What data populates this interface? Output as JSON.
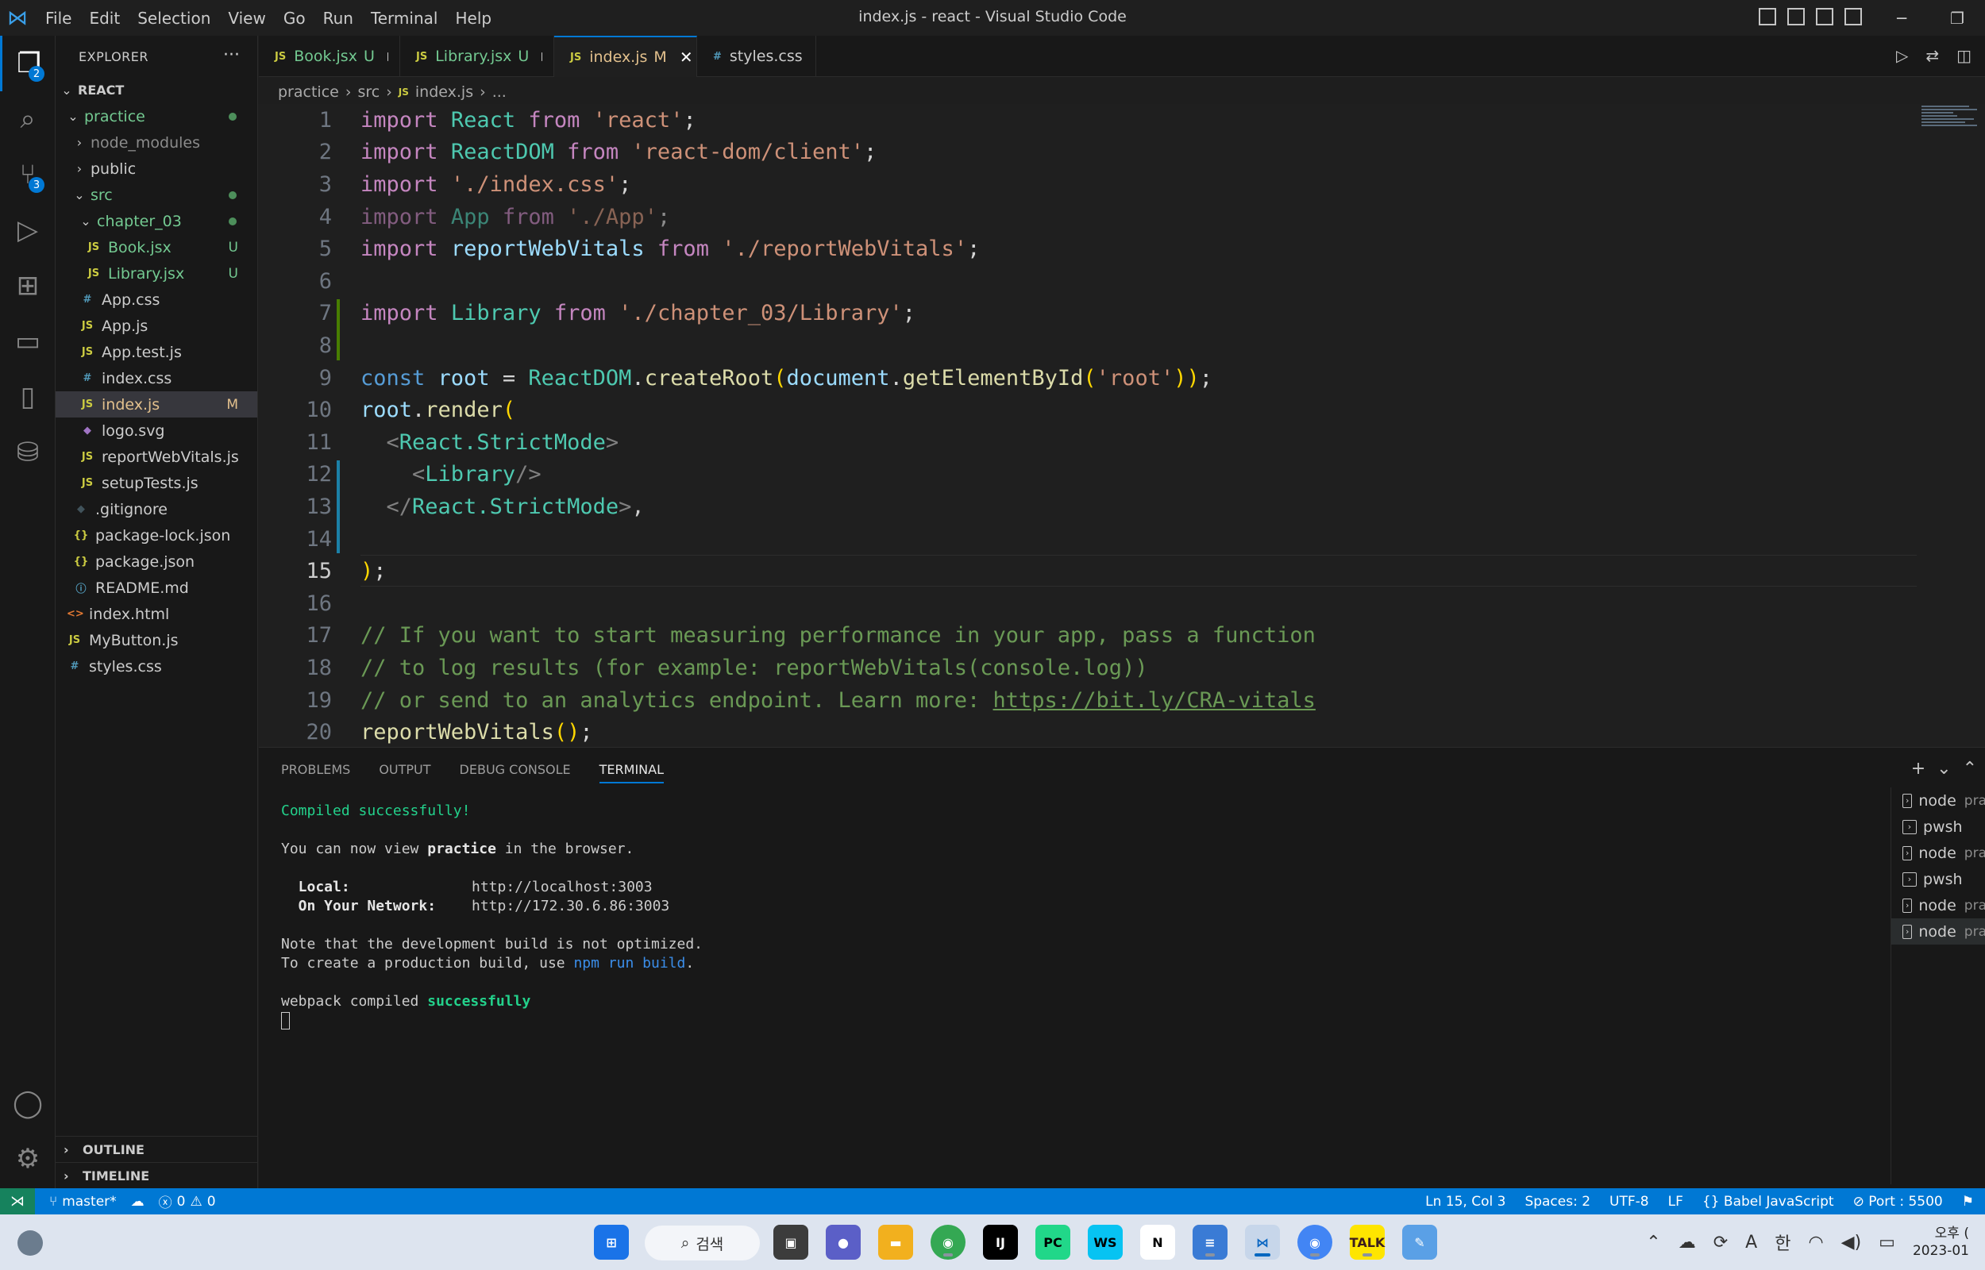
{
  "window": {
    "title": "index.js - react - Visual Studio Code",
    "menu": [
      "File",
      "Edit",
      "Selection",
      "View",
      "Go",
      "Run",
      "Terminal",
      "Help"
    ]
  },
  "activity_bar": {
    "explorer_badge": "2",
    "scm_badge": "3"
  },
  "sidebar": {
    "title": "EXPLORER",
    "root": "REACT",
    "tree": [
      {
        "label": "practice",
        "kind": "folder-open",
        "indent": 1,
        "color": "#73c991",
        "dot": true
      },
      {
        "label": "node_modules",
        "kind": "folder",
        "indent": 2,
        "color": "#8b8b8b"
      },
      {
        "label": "public",
        "kind": "folder",
        "indent": 2,
        "color": "#cccccc"
      },
      {
        "label": "src",
        "kind": "folder-open",
        "indent": 2,
        "color": "#73c991",
        "dot": true
      },
      {
        "label": "chapter_03",
        "kind": "folder-open",
        "indent": 3,
        "color": "#73c991",
        "dot": true
      },
      {
        "label": "Book.jsx",
        "kind": "js",
        "indent": 4,
        "color": "#73c991",
        "status": "U"
      },
      {
        "label": "Library.jsx",
        "kind": "js",
        "indent": 4,
        "color": "#73c991",
        "status": "U"
      },
      {
        "label": "App.css",
        "kind": "css",
        "indent": 3,
        "color": "#cccccc"
      },
      {
        "label": "App.js",
        "kind": "js",
        "indent": 3,
        "color": "#cccccc"
      },
      {
        "label": "App.test.js",
        "kind": "js",
        "indent": 3,
        "color": "#cccccc"
      },
      {
        "label": "index.css",
        "kind": "css",
        "indent": 3,
        "color": "#cccccc"
      },
      {
        "label": "index.js",
        "kind": "js",
        "indent": 3,
        "color": "#e2c08d",
        "status": "M",
        "selected": true
      },
      {
        "label": "logo.svg",
        "kind": "svg",
        "indent": 3,
        "color": "#cccccc"
      },
      {
        "label": "reportWebVitals.js",
        "kind": "js",
        "indent": 3,
        "color": "#cccccc"
      },
      {
        "label": "setupTests.js",
        "kind": "js",
        "indent": 3,
        "color": "#cccccc"
      },
      {
        "label": ".gitignore",
        "kind": "git",
        "indent": 2,
        "color": "#cccccc"
      },
      {
        "label": "package-lock.json",
        "kind": "json",
        "indent": 2,
        "color": "#cccccc"
      },
      {
        "label": "package.json",
        "kind": "json",
        "indent": 2,
        "color": "#cccccc"
      },
      {
        "label": "README.md",
        "kind": "info",
        "indent": 2,
        "color": "#cccccc"
      },
      {
        "label": "index.html",
        "kind": "html",
        "indent": 1,
        "color": "#cccccc"
      },
      {
        "label": "MyButton.js",
        "kind": "js",
        "indent": 1,
        "color": "#cccccc"
      },
      {
        "label": "styles.css",
        "kind": "css",
        "indent": 1,
        "color": "#cccccc"
      }
    ],
    "outline_label": "OUTLINE",
    "timeline_label": "TIMELINE"
  },
  "tabs": [
    {
      "label": "Book.jsx",
      "mark": "U",
      "dirty": true,
      "color": "#73c991"
    },
    {
      "label": "Library.jsx",
      "mark": "U",
      "dirty": true,
      "color": "#73c991"
    },
    {
      "label": "index.js",
      "mark": "M",
      "active": true,
      "color": "#e2c08d"
    },
    {
      "label": "styles.css",
      "mark": "",
      "color": "#cccccc"
    }
  ],
  "breadcrumb": [
    "practice",
    "src",
    "index.js",
    "..."
  ],
  "editor": {
    "current_line": 15,
    "lines": [
      "import React from 'react';",
      "import ReactDOM from 'react-dom/client';",
      "import './index.css';",
      "import App from './App';",
      "import reportWebVitals from './reportWebVitals';",
      "",
      "import Library from './chapter_03/Library';",
      "",
      "const root = ReactDOM.createRoot(document.getElementById('root'));",
      "root.render(",
      "  <React.StrictMode>",
      "    <Library/>",
      "  </React.StrictMode>,",
      "",
      ");",
      "",
      "// If you want to start measuring performance in your app, pass a function",
      "// to log results (for example: reportWebVitals(console.log))",
      "// or send to an analytics endpoint. Learn more: https://bit.ly/CRA-vitals",
      "reportWebVitals();"
    ]
  },
  "panel": {
    "tabs": [
      "PROBLEMS",
      "OUTPUT",
      "DEBUG CONSOLE",
      "TERMINAL"
    ],
    "active_tab": "TERMINAL",
    "terminal": {
      "compiled": "Compiled successfully!",
      "view_pre": "You can now view ",
      "view_app": "practice",
      "view_post": " in the browser.",
      "local_label": "  Local:",
      "local_url": "http://localhost:3003",
      "network_label": "  On Your Network:",
      "network_url": "http://172.30.6.86:3003",
      "note1": "Note that the development build is not optimized.",
      "note2_pre": "To create a production build, use ",
      "note2_cmd": "npm run build",
      "note2_post": ".",
      "webpack_pre": "webpack compiled ",
      "webpack_ok": "successfully"
    },
    "terminals": [
      {
        "name": "node",
        "sub": "pra"
      },
      {
        "name": "pwsh",
        "sub": ""
      },
      {
        "name": "node",
        "sub": "pra"
      },
      {
        "name": "pwsh",
        "sub": ""
      },
      {
        "name": "node",
        "sub": "pra"
      },
      {
        "name": "node",
        "sub": "pra",
        "selected": true
      }
    ]
  },
  "statusbar": {
    "branch": "master*",
    "errors": "0",
    "warnings": "0",
    "position": "Ln 15, Col 3",
    "spaces": "Spaces: 2",
    "encoding": "UTF-8",
    "eol": "LF",
    "language": "Babel JavaScript",
    "port": "Port : 5500"
  },
  "taskbar": {
    "search_label": "검색",
    "ime": "A",
    "lang": "한",
    "time": "오후 (",
    "date": "2023-01"
  }
}
